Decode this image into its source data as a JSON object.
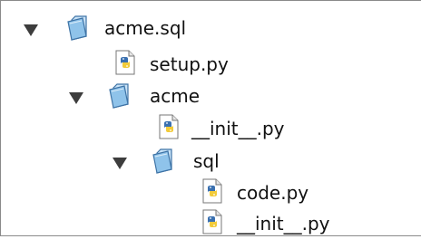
{
  "tree": {
    "root": {
      "label": "acme.sql",
      "expanded": true,
      "icon": "folder-icon"
    },
    "setup": {
      "label": "setup.py",
      "icon": "python-file-icon"
    },
    "acme": {
      "label": "acme",
      "expanded": true,
      "icon": "folder-icon"
    },
    "acme_init": {
      "label": "__init__.py",
      "icon": "python-file-icon"
    },
    "sql": {
      "label": "sql",
      "expanded": true,
      "icon": "folder-icon"
    },
    "code": {
      "label": "code.py",
      "icon": "python-file-icon"
    },
    "sql_init": {
      "label": "__init__.py",
      "icon": "python-file-icon"
    }
  },
  "colors": {
    "folder_fill": "#8fc3ea",
    "folder_stroke": "#3e73a6",
    "python_blue": "#3a70b0",
    "python_yellow": "#f2cb3a"
  }
}
